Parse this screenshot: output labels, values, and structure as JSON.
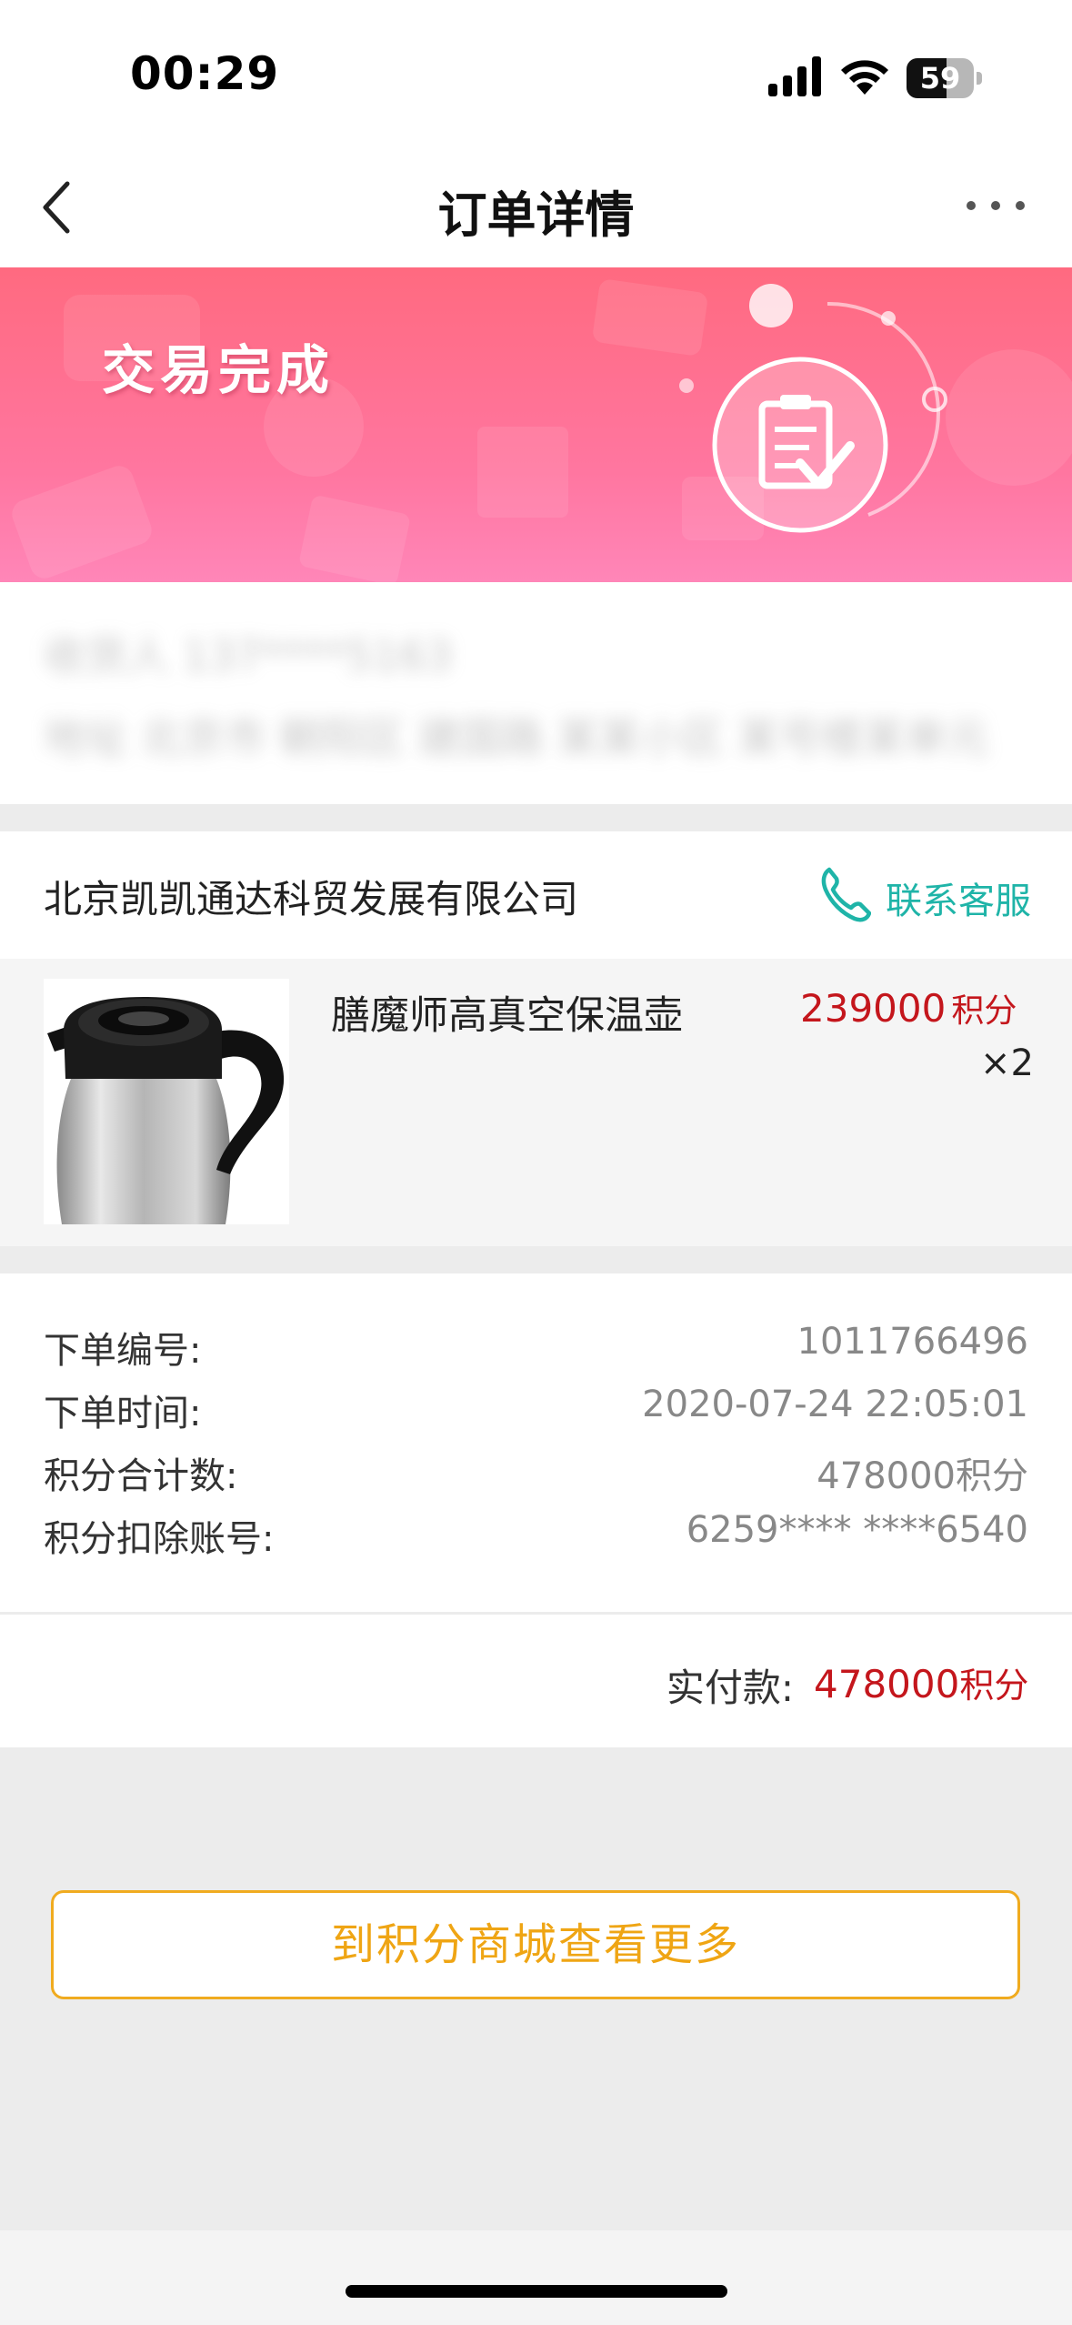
{
  "status_bar": {
    "time": "00:29",
    "battery": "59",
    "battery_level": 0.59,
    "icons": [
      "signal-icon",
      "wifi-icon",
      "battery-icon"
    ]
  },
  "nav": {
    "title": "订单详情",
    "icons": [
      "back-chevron-icon",
      "more-dots-icon"
    ]
  },
  "banner": {
    "status": "交易完成",
    "icon": "order-complete-clipboard-icon",
    "colors": {
      "from": "#ff6a80",
      "to": "#ff86b8"
    }
  },
  "blurred": {
    "line1": "收货人 137****5163",
    "line2": "地址 北京市 朝阳区 建国路 某某小区 某号楼某单元"
  },
  "merchant": {
    "name": "北京凯凯通达科贸发展有限公司",
    "contact_label": "联系客服",
    "contact_color": "#1fb4a8"
  },
  "product": {
    "name": "膳魔师高真空保温壶",
    "price": "239000",
    "price_unit": "积分",
    "quantity": "×2",
    "image": "thermos-jug-image"
  },
  "order_info": [
    {
      "label": "下单编号:",
      "value": "1011766496"
    },
    {
      "label": "下单时间:",
      "value": "2020-07-24 22:05:01"
    },
    {
      "label": "积分合计数:",
      "value": "478000积分"
    },
    {
      "label": "积分扣除账号:",
      "value": "6259**** ****6540"
    }
  ],
  "payment": {
    "label": "实付款:",
    "amount": "478000",
    "unit": "积分",
    "color": "#c4161c"
  },
  "cta": {
    "label": "到积分商城查看更多",
    "color": "#efa514"
  }
}
